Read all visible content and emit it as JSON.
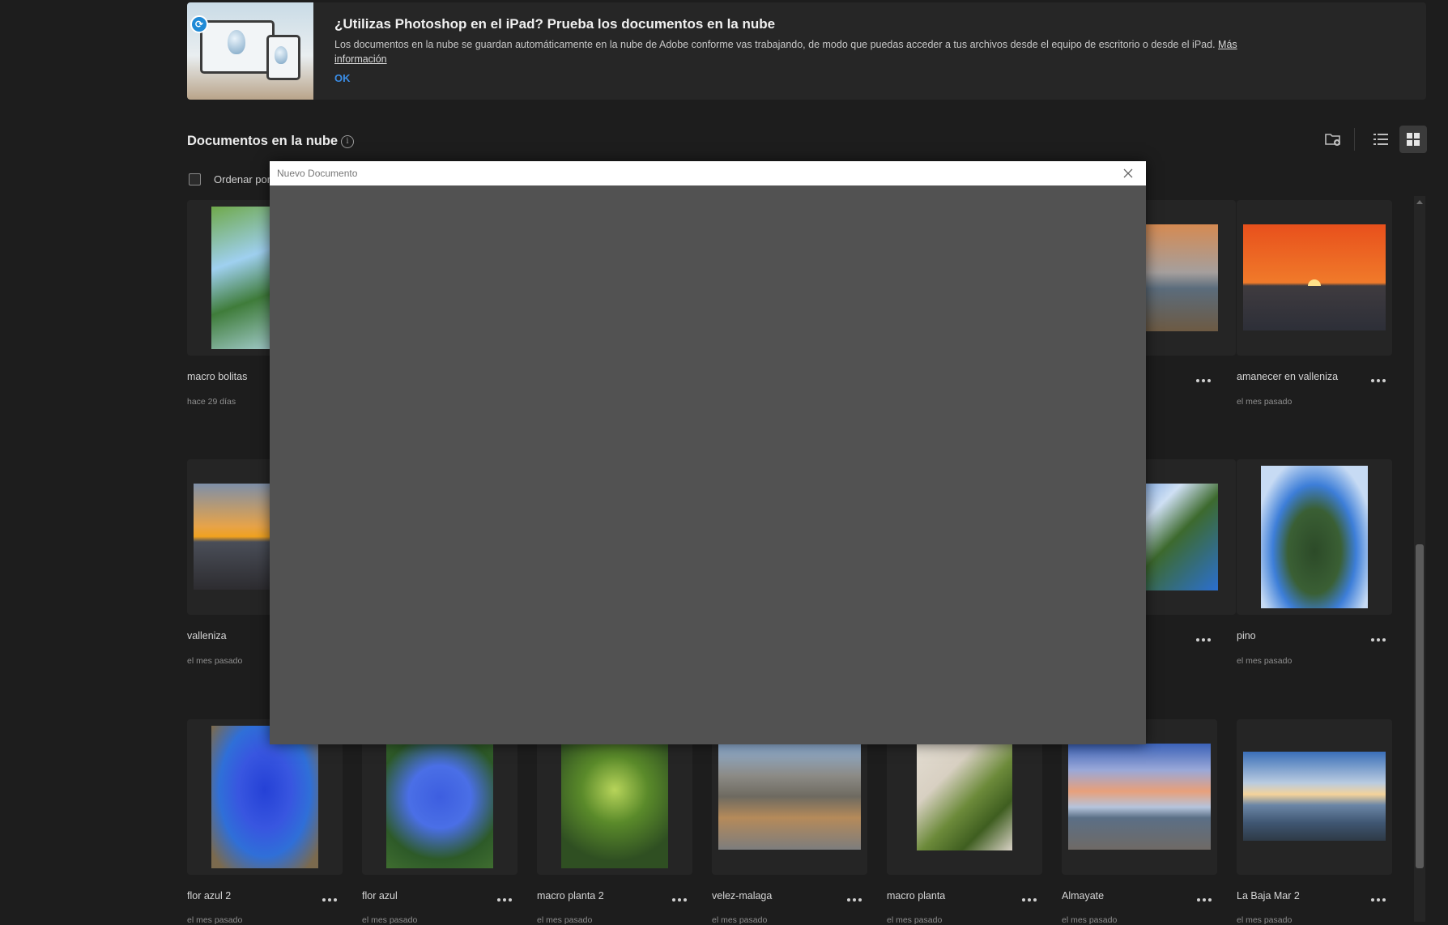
{
  "banner": {
    "title": "¿Utilizas Photoshop en el iPad? Prueba los documentos en la nube",
    "body": "Los documentos en la nube se guardan automáticamente en la nube de Adobe conforme vas trabajando, de modo que puedas acceder a tus archivos desde el equipo de escritorio o desde el iPad.",
    "link": "Más información",
    "ok": "OK"
  },
  "section": {
    "title": "Documentos en la nube",
    "sort_label": "Ordenar por"
  },
  "dialog": {
    "title": "Nuevo Documento"
  },
  "documents": [
    {
      "name": "macro bolitas",
      "date": "hace 29 días"
    },
    {
      "name": "",
      "date": ""
    },
    {
      "name": "amanecer en valleniza",
      "date": "el mes pasado"
    },
    {
      "name": "valleniza",
      "date": "el mes pasado"
    },
    {
      "name": "",
      "date": ""
    },
    {
      "name": "pino",
      "date": "el mes pasado"
    },
    {
      "name": "flor azul 2",
      "date": "el mes pasado"
    },
    {
      "name": "flor azul",
      "date": "el mes pasado"
    },
    {
      "name": "macro planta 2",
      "date": "el mes pasado"
    },
    {
      "name": "velez-malaga",
      "date": "el mes pasado"
    },
    {
      "name": "macro planta",
      "date": "el mes pasado"
    },
    {
      "name": "Almayate",
      "date": "el mes pasado"
    },
    {
      "name": "La Baja Mar 2",
      "date": "el mes pasado"
    }
  ],
  "colors": {
    "background": "#1d1d1d",
    "accent": "#3a8de6",
    "dialog": "#525252"
  },
  "icons": [
    "sync-icon",
    "info-icon",
    "new-folder-icon",
    "list-view-icon",
    "grid-view-icon",
    "more-icon",
    "close-icon"
  ]
}
